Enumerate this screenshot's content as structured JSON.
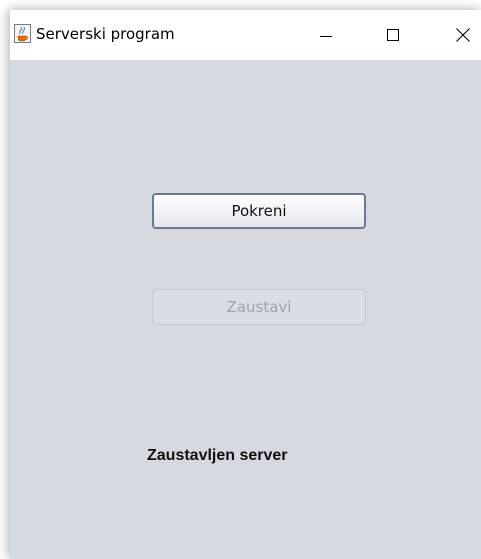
{
  "window": {
    "title": "Serverski program",
    "icon": "java-coffee-cup-icon",
    "controls": [
      "minimize-icon",
      "maximize-icon",
      "close-icon"
    ]
  },
  "buttons": {
    "start_label": "Pokreni",
    "stop_label": "Zaustavi"
  },
  "status": {
    "text": "Zaustavljen server"
  },
  "colors": {
    "background": "#d6d9e0",
    "titlebar": "#ffffff",
    "button_border": "#6c7a90",
    "disabled_text": "#a0a4ab"
  }
}
